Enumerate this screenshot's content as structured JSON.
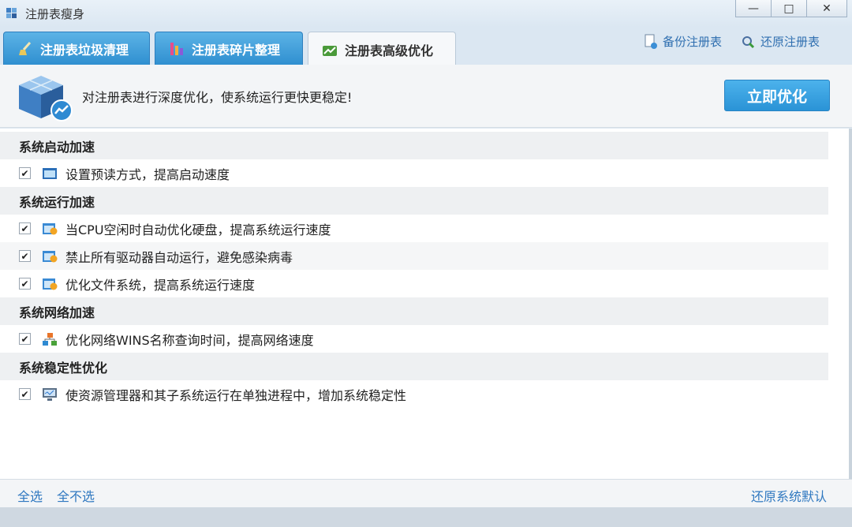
{
  "window": {
    "title": "注册表瘦身",
    "minimize": "—",
    "maximize": "□",
    "close": "✕"
  },
  "tabs": [
    {
      "label": "注册表垃圾清理",
      "icon": "broom-icon",
      "active": false
    },
    {
      "label": "注册表碎片整理",
      "icon": "defrag-icon",
      "active": false
    },
    {
      "label": "注册表高级优化",
      "icon": "chart-up-icon",
      "active": true
    }
  ],
  "toolbar": {
    "backup_label": "备份注册表",
    "restore_label": "还原注册表"
  },
  "banner": {
    "description": "对注册表进行深度优化，使系统运行更快更稳定!",
    "optimize_button": "立即优化"
  },
  "sections": [
    {
      "title": "系统启动加速",
      "items": [
        {
          "label": "设置预读方式，提高启动速度",
          "checked": true,
          "icon": "window-icon"
        }
      ]
    },
    {
      "title": "系统运行加速",
      "items": [
        {
          "label": "当CPU空闲时自动优化硬盘，提高系统运行速度",
          "checked": true,
          "icon": "settings-window-icon"
        },
        {
          "label": "禁止所有驱动器自动运行，避免感染病毒",
          "checked": true,
          "icon": "settings-window-icon"
        },
        {
          "label": "优化文件系统，提高系统运行速度",
          "checked": true,
          "icon": "settings-window-icon"
        }
      ]
    },
    {
      "title": "系统网络加速",
      "items": [
        {
          "label": "优化网络WINS名称查询时间，提高网络速度",
          "checked": true,
          "icon": "network-icon"
        }
      ]
    },
    {
      "title": "系统稳定性优化",
      "items": [
        {
          "label": "使资源管理器和其子系统运行在单独进程中，增加系统稳定性",
          "checked": true,
          "icon": "monitor-icon"
        }
      ]
    }
  ],
  "footer": {
    "select_all": "全选",
    "select_none": "全不选",
    "restore_default": "还原系统默认"
  },
  "colors": {
    "accent": "#2f93d6",
    "link": "#2f78c0",
    "section_bg": "#eef0f2"
  }
}
